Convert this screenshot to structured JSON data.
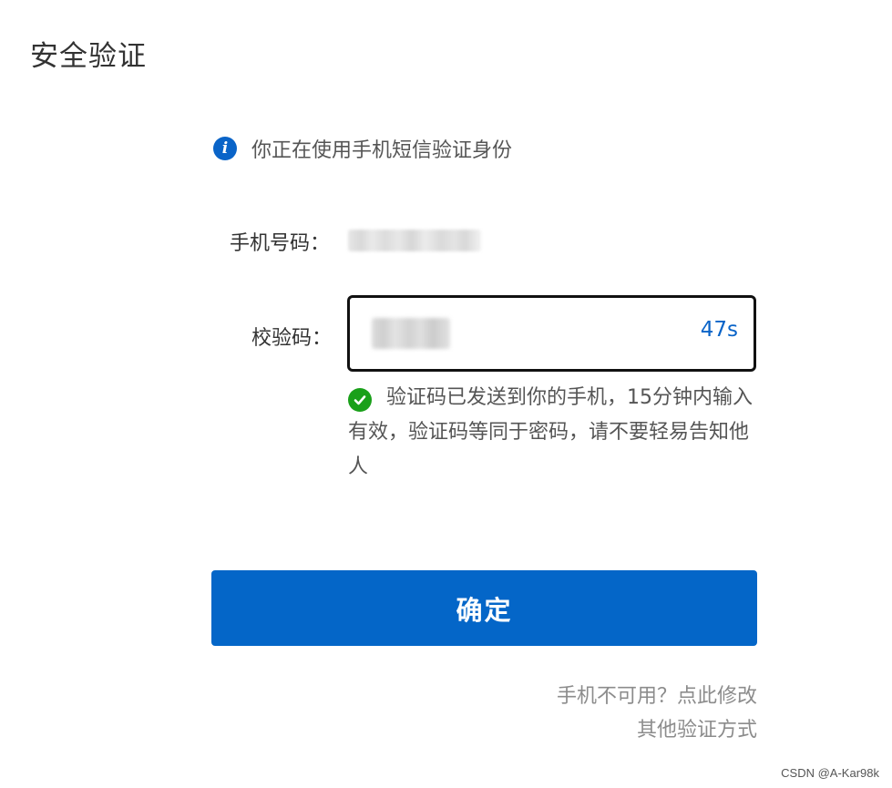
{
  "page": {
    "title": "安全验证"
  },
  "notice": {
    "icon": "info-icon",
    "text": "你正在使用手机短信验证身份"
  },
  "form": {
    "phone_label": "手机号码：",
    "phone_value_obscured": true,
    "code_label": "校验码：",
    "code_value_obscured": true,
    "countdown": "47s"
  },
  "success": {
    "icon": "check-circle-icon",
    "text": "验证码已发送到你的手机，15分钟内输入有效，验证码等同于密码，请不要轻易告知他人"
  },
  "actions": {
    "confirm_label": "确定",
    "phone_unavailable_link": "手机不可用？点此修改",
    "other_methods_link": "其他验证方式"
  },
  "watermark": "CSDN @A-Kar98k",
  "colors": {
    "accent": "#0466c8",
    "success": "#1aa01a",
    "muted_text": "#8c8c8c"
  }
}
